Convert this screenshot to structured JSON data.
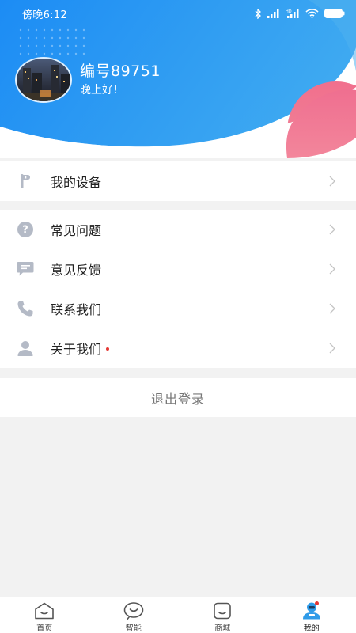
{
  "status_bar": {
    "time": "傍晚6:12",
    "icons": [
      "bluetooth-icon",
      "signal-icon",
      "hd-signal-icon",
      "wifi-icon",
      "battery-icon"
    ]
  },
  "profile": {
    "id_label": "编号89751",
    "greeting": "晚上好!"
  },
  "menu": {
    "device": {
      "label": "我的设备",
      "icon": "device-icon"
    },
    "items": [
      {
        "label": "常见问题",
        "icon": "question-icon"
      },
      {
        "label": "意见反馈",
        "icon": "feedback-icon"
      },
      {
        "label": "联系我们",
        "icon": "phone-icon"
      },
      {
        "label": "关于我们",
        "icon": "person-icon",
        "badge": true
      }
    ]
  },
  "logout_label": "退出登录",
  "tabbar": {
    "tabs": [
      {
        "label": "首页",
        "icon": "home-icon"
      },
      {
        "label": "智能",
        "icon": "smart-icon"
      },
      {
        "label": "商城",
        "icon": "mall-icon"
      },
      {
        "label": "我的",
        "icon": "profile-icon",
        "active": true,
        "badge": true
      }
    ]
  },
  "colors": {
    "header_gradient_start": "#1e8ff5",
    "header_gradient_end": "#3aa7f2",
    "accent_pink": "#f26a8a",
    "icon_gray": "#b4bac6",
    "active_tab_blue": "#2f9be8",
    "badge_red": "#e53935"
  }
}
